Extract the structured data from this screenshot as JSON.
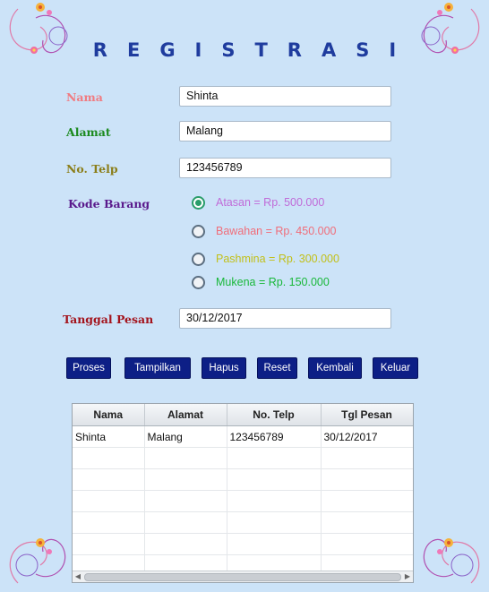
{
  "title": "REGISTRASI",
  "colors": {
    "background": "#cce3f8",
    "title": "#1f3c9e",
    "label_nama": "#f07c82",
    "label_alamat": "#1b8a1e",
    "label_telp": "#8b7e1a",
    "label_kode": "#5a1a8c",
    "label_tanggal": "#a3131c",
    "button_bg": "#0d1f86",
    "radio_atasan": "#c06bd8",
    "radio_bawahan": "#f06e7a",
    "radio_pashmina": "#c2c01a",
    "radio_mukena": "#19b83a"
  },
  "form": {
    "nama_label": "Nama",
    "nama_value": "Shinta",
    "alamat_label": "Alamat",
    "alamat_value": "Malang",
    "telp_label": "No. Telp",
    "telp_value": "123456789",
    "kode_label": "Kode Barang",
    "options": [
      {
        "label": "Atasan = Rp. 500.000",
        "selected": true
      },
      {
        "label": "Bawahan = Rp. 450.000",
        "selected": false
      },
      {
        "label": "Pashmina = Rp. 300.000",
        "selected": false
      },
      {
        "label": "Mukena = Rp. 150.000",
        "selected": false
      }
    ],
    "tanggal_label": "Tanggal Pesan",
    "tanggal_value": "30/12/2017"
  },
  "buttons": {
    "proses": "Proses",
    "tampilkan": "Tampilkan",
    "hapus": "Hapus",
    "reset": "Reset",
    "kembali": "Kembali",
    "keluar": "Keluar"
  },
  "table": {
    "columns": [
      "Nama",
      "Alamat",
      "No. Telp",
      "Tgl Pesan"
    ],
    "rows": [
      [
        "Shinta",
        "Malang",
        "123456789",
        "30/12/2017"
      ]
    ]
  }
}
